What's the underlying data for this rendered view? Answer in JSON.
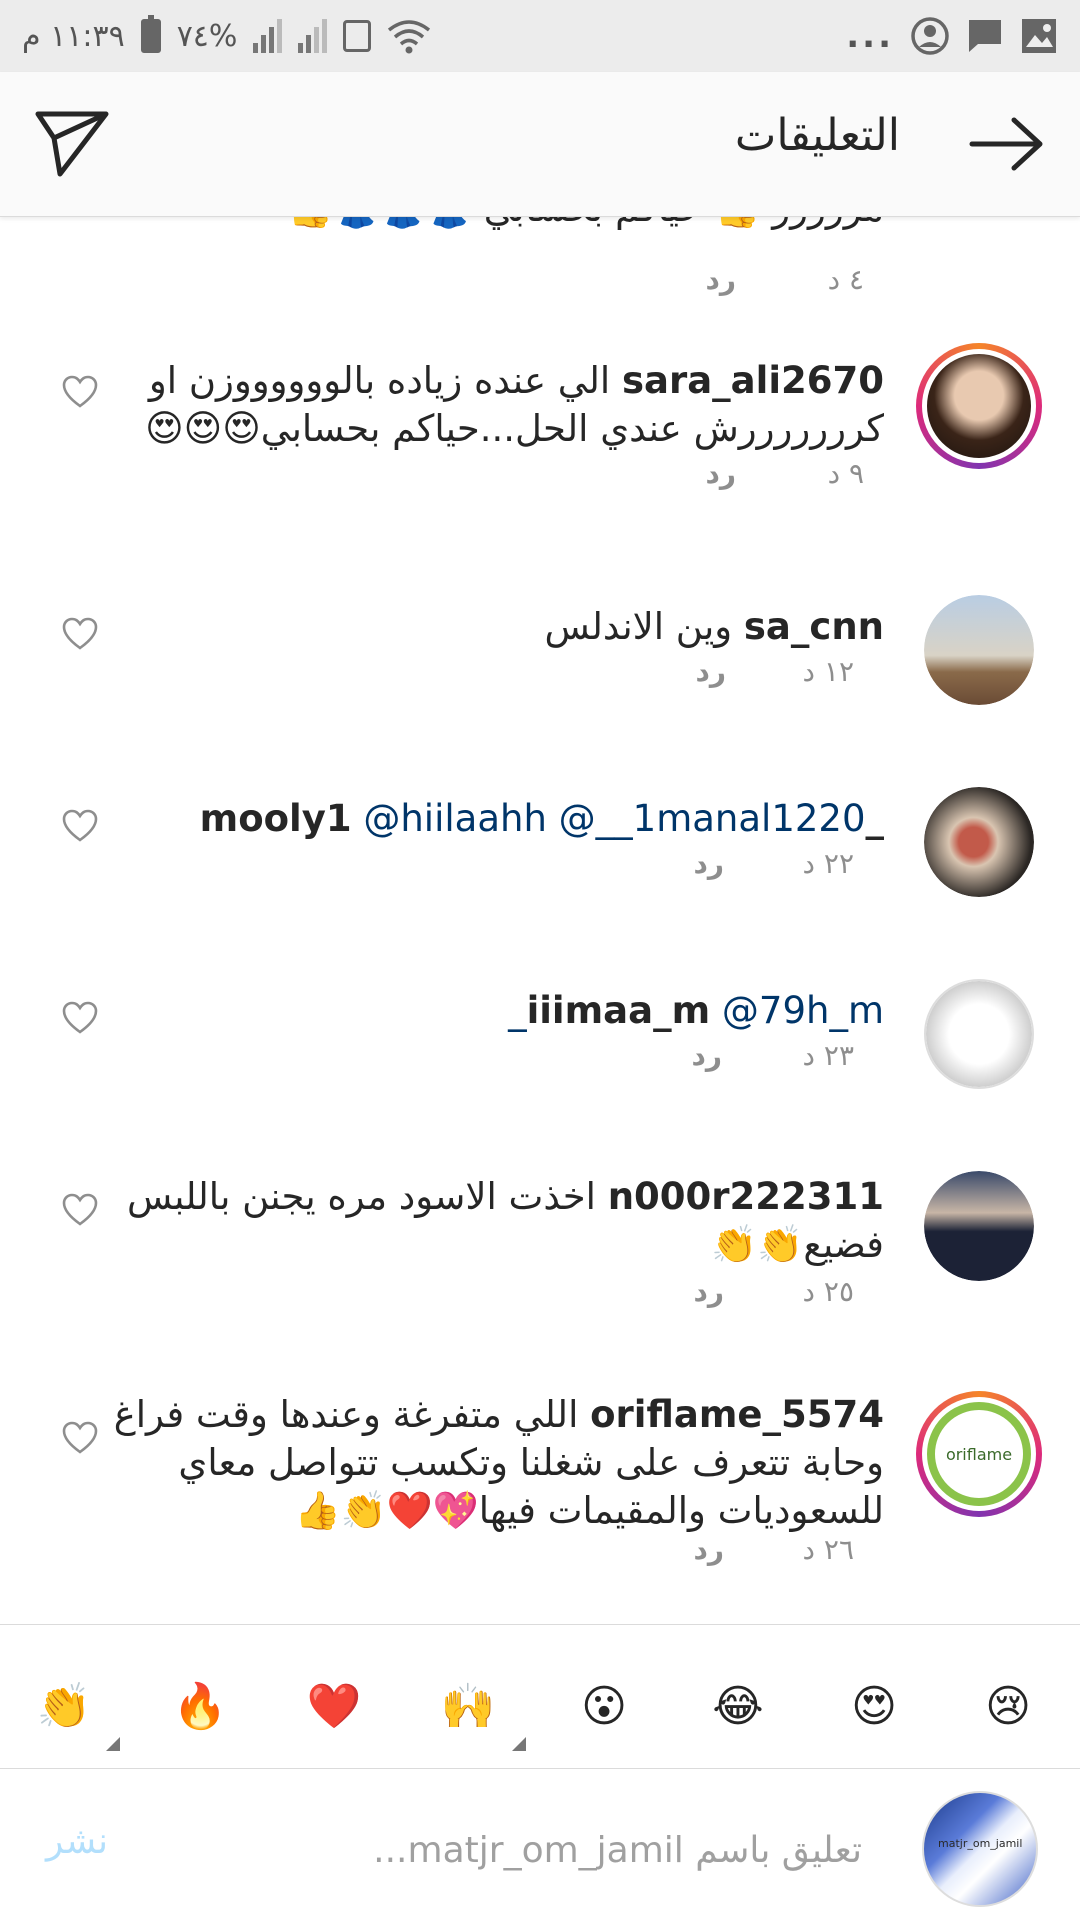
{
  "status_bar": {
    "time": "١١:٣٩ م",
    "battery": "%٧٤",
    "overflow": "..."
  },
  "header": {
    "title": "التعليقات"
  },
  "partial_comment": {
    "text": "مررررر 👍 حياكم بحسابي 👗👗👗👍",
    "time": "٤ د",
    "reply": "رد"
  },
  "comments": [
    {
      "username": "sara_ali2670",
      "text": "الي عنده زياده بالووووووزن او كرررررررش عندي الحل...حياكم بحسابي😍😍😍",
      "time": "٩ د",
      "reply": "رد",
      "avatar_color": "#5a3a2a",
      "ring": true
    },
    {
      "username": "sa_cnn",
      "text": "وين الاندلس",
      "time": "١٢ د",
      "reply": "رد",
      "avatar_color": "#9aa7b8",
      "ring": false
    },
    {
      "username": "_mooly1",
      "mentions": [
        "@hiilaahh",
        "@__1manal1220"
      ],
      "time": "٢٢ د",
      "reply": "رد",
      "avatar_color": "#3d3a36",
      "ring": false
    },
    {
      "username": "iiimaa_m",
      "mentions": [
        "@79h_m_"
      ],
      "time": "٢٣ د",
      "reply": "رد",
      "avatar_color": "#e6e6e6",
      "ring": false
    },
    {
      "username": "n000r222311",
      "text": "اخذت الاسود مره يجنن  باللبس فضيع👏👏",
      "time": "٢٥ د",
      "reply": "رد",
      "avatar_color": "#1f2a44",
      "ring": false
    },
    {
      "username": "oriflame_5574",
      "text": "اللي متفرغة وعندها وقت فراغ وحابة تتعرف على شغلنا وتكسب تتواصل معاي للسعوديات والمقيمات فيها💖❤️👏👍",
      "time": "٢٦ د",
      "reply": "رد",
      "avatar_color": "#ffffff",
      "avatar_label": "oriflame",
      "ring": true
    }
  ],
  "emoji_bar": [
    "😢",
    "😍",
    "😂",
    "😮",
    "🙌",
    "❤️",
    "🔥",
    "👏"
  ],
  "compose": {
    "placeholder": "تعليق باسم matjr_om_jamil...",
    "post_label": "نشر",
    "avatar_label": "matjr_om_jamil"
  },
  "colors": {
    "mention": "#003569",
    "meta": "#8e8e8e",
    "post_disabled": "#b2dffc",
    "ring_start": "#f58529",
    "ring_end": "#dd2a7b"
  }
}
